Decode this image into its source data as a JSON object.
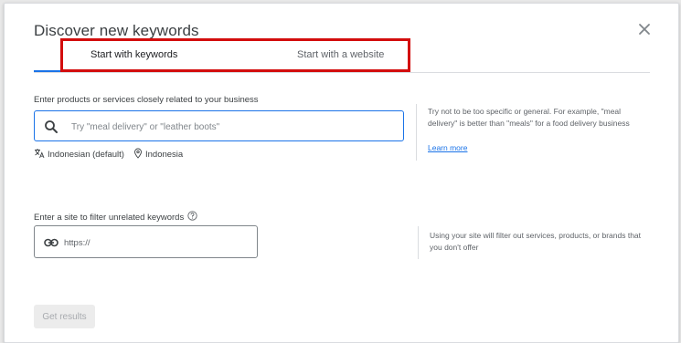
{
  "dialog": {
    "title": "Discover new keywords",
    "close_icon": "close-icon"
  },
  "tabs": [
    {
      "label": "Start with keywords",
      "active": true
    },
    {
      "label": "Start with a website",
      "active": false
    }
  ],
  "keywords_section": {
    "label": "Enter products or services closely related to your business",
    "placeholder": "Try \"meal delivery\" or \"leather boots\"",
    "language": "Indonesian (default)",
    "location": "Indonesia",
    "help_text": "Try not to be too specific or general. For example, \"meal delivery\" is better than \"meals\" for a food delivery business",
    "learn_more": "Learn more"
  },
  "site_section": {
    "label": "Enter a site to filter unrelated keywords",
    "placeholder": "https://",
    "help_text": "Using your site will filter out services, products, or brands that you don't offer"
  },
  "actions": {
    "get_results": "Get results"
  },
  "colors": {
    "accent": "#1a73e8",
    "highlight": "#d30d0d",
    "disabled_bg": "#ececec",
    "disabled_text": "#a8abaf"
  }
}
